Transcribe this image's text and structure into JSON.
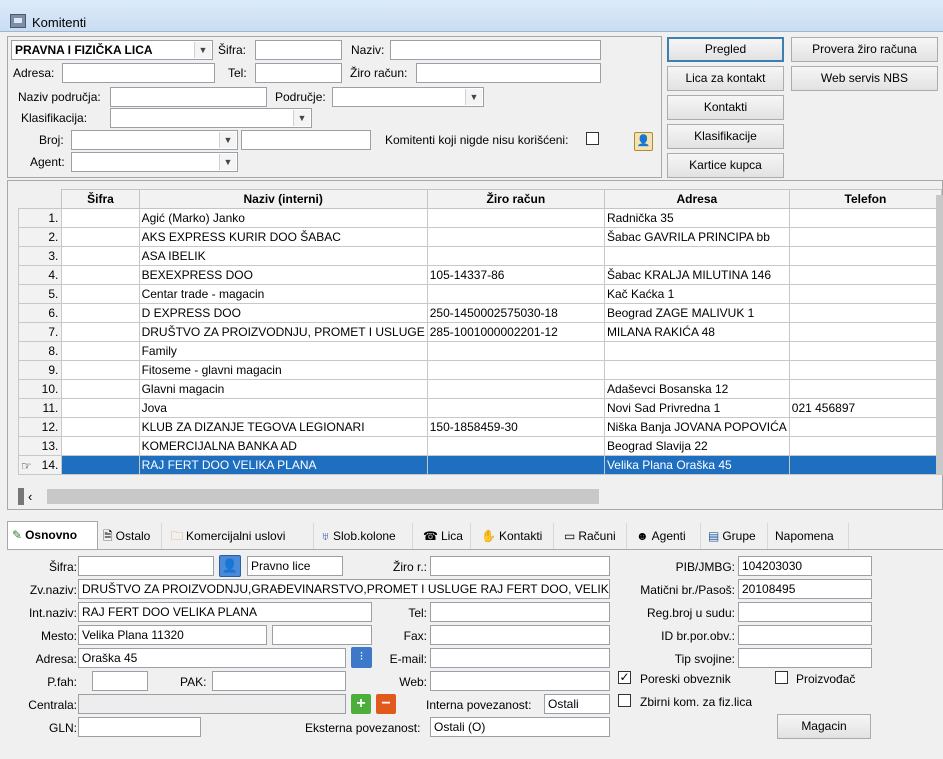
{
  "window": {
    "title": "Komitenti"
  },
  "filter": {
    "type_value": "PRAVNA I FIZIČKA LICA",
    "sifra_label": "Šifra:",
    "sifra_value": "",
    "naziv_label": "Naziv:",
    "naziv_value": "",
    "adresa_label": "Adresa:",
    "adresa_value": "",
    "tel_label": "Tel:",
    "tel_value": "",
    "ziro_label": "Žiro račun:",
    "ziro_value": "",
    "naziv_podrucja_label": "Naziv područja:",
    "naziv_podrucja_value": "",
    "podrucje_label": "Područje:",
    "podrucje_value": "",
    "klasifikacija_label": "Klasifikacija:",
    "klasifikacija_value": "",
    "broj_label": "Broj:",
    "broj_value": "",
    "broj_extra_value": "",
    "agent_label": "Agent:",
    "agent_value": "",
    "nekorisceni_label": "Komitenti koji nigde nisu korišćeni:",
    "nekorisceni_checked": false
  },
  "buttons": {
    "pregled": "Pregled",
    "lica_za_kontakt": "Lica za kontakt",
    "kontakti": "Kontakti",
    "klasifikacije": "Klasifikacije",
    "kartice_kupca": "Kartice kupca",
    "provera_ziro": "Provera žiro računa",
    "web_servis": "Web servis NBS"
  },
  "grid": {
    "columns": [
      "Šifra",
      "Naziv (interni)",
      "Žiro račun",
      "Adresa",
      "Telefon"
    ],
    "rows": [
      {
        "n": "1.",
        "sifra": "",
        "naziv": "Agić (Marko) Janko",
        "ziro": "",
        "adresa": "Radnička 35",
        "telefon": ""
      },
      {
        "n": "2.",
        "sifra": "",
        "naziv": "AKS EXPRESS KURIR DOO ŠABAC",
        "ziro": "",
        "adresa": "Šabac GAVRILA PRINCIPA bb",
        "telefon": ""
      },
      {
        "n": "3.",
        "sifra": "",
        "naziv": "ASA IBELIK",
        "ziro": "",
        "adresa": "",
        "telefon": ""
      },
      {
        "n": "4.",
        "sifra": "",
        "naziv": "BEXEXPRESS DOO",
        "ziro": "105-14337-86",
        "adresa": "Šabac KRALJA MILUTINA 146",
        "telefon": ""
      },
      {
        "n": "5.",
        "sifra": "",
        "naziv": "Centar trade - magacin",
        "ziro": "",
        "adresa": "Kač Kaćka 1",
        "telefon": ""
      },
      {
        "n": "6.",
        "sifra": "",
        "naziv": "D EXPRESS DOO",
        "ziro": "250-1450002575030-18",
        "adresa": "Beograd ZAGE MALIVUK 1",
        "telefon": ""
      },
      {
        "n": "7.",
        "sifra": "",
        "naziv": "DRUŠTVO ZA PROIZVODNJU, PROMET I USLUGE",
        "ziro": "285-1001000002201-12",
        "adresa": "MILANA RAKIĆA 48",
        "telefon": ""
      },
      {
        "n": "8.",
        "sifra": "",
        "naziv": "Family",
        "ziro": "",
        "adresa": "",
        "telefon": ""
      },
      {
        "n": "9.",
        "sifra": "",
        "naziv": "Fitoseme - glavni magacin",
        "ziro": "",
        "adresa": "",
        "telefon": ""
      },
      {
        "n": "10.",
        "sifra": "",
        "naziv": "Glavni magacin",
        "ziro": "",
        "adresa": "Adaševci Bosanska 12",
        "telefon": ""
      },
      {
        "n": "11.",
        "sifra": "",
        "naziv": "Jova",
        "ziro": "",
        "adresa": "Novi Sad Privredna 1",
        "telefon": "021 456897"
      },
      {
        "n": "12.",
        "sifra": "",
        "naziv": "KLUB ZA DIZANJE TEGOVA  LEGIONARI",
        "ziro": "150-1858459-30",
        "adresa": "Niška Banja JOVANA POPOVIĆA",
        "telefon": ""
      },
      {
        "n": "13.",
        "sifra": "",
        "naziv": "KOMERCIJALNA BANKA AD",
        "ziro": "",
        "adresa": "Beograd Slavija 22",
        "telefon": ""
      },
      {
        "n": "14.",
        "sifra": "",
        "naziv": "RAJ FERT DOO VELIKA PLANA",
        "ziro": "",
        "adresa": "Velika Plana Oraška 45",
        "telefon": ""
      }
    ],
    "selected_row": 14
  },
  "tabs": [
    "Osnovno",
    "Ostalo",
    "Komercijalni uslovi",
    "Slob.kolone",
    "Lica",
    "Kontakti",
    "Računi",
    "Agenti",
    "Grupe",
    "Napomena"
  ],
  "detail": {
    "sifra_label": "Šifra:",
    "sifra_value": "",
    "tip_value": "Pravno lice",
    "ziro_label": "Žiro r.:",
    "ziro_value": "",
    "pib_label": "PIB/JMBG:",
    "pib_value": "104203030",
    "zvnaziv_label": "Zv.naziv:",
    "zvnaziv_value": "DRUŠTVO ZA PROIZVODNJU,GRAĐEVINARSTVO,PROMET I USLUGE RAJ FERT DOO, VELIKA PLANA",
    "maticni_label": "Matični br./Pasoš:",
    "maticni_value": "20108495",
    "intnaziv_label": "Int.naziv:",
    "intnaziv_value": "RAJ FERT DOO VELIKA PLANA",
    "tel_label": "Tel:",
    "tel_value": "",
    "regbroj_label": "Reg.broj u sudu:",
    "regbroj_value": "",
    "mesto_label": "Mesto:",
    "mesto_value": "Velika Plana  11320",
    "mesto_extra": "",
    "fax_label": "Fax:",
    "fax_value": "",
    "idbr_label": "ID br.por.obv.:",
    "idbr_value": "",
    "adresa_label": "Adresa:",
    "adresa_value": "Oraška 45",
    "email_label": "E-mail:",
    "email_value": "",
    "tip_svojine_label": "Tip svojine:",
    "tip_svojine_value": "",
    "pfah_label": "P.fah:",
    "pfah_value": "",
    "pak_label": "PAK:",
    "pak_value": "",
    "web_label": "Web:",
    "web_value": "",
    "poreski_label": "Poreski obveznik",
    "poreski_checked": true,
    "proizvodjac_label": "Proizvođač",
    "proizvodjac_checked": false,
    "centrala_label": "Centrala:",
    "centrala_value": "",
    "interna_label": "Interna povezanost:",
    "interna_value": "Ostali",
    "zbirni_label": "Zbirni kom. za fiz.lica",
    "zbirni_checked": false,
    "gln_label": "GLN:",
    "gln_value": "",
    "eksterna_label": "Eksterna povezanost:",
    "eksterna_value": "Ostali (O)",
    "magacin_button": "Magacin"
  },
  "colors": {
    "selection": "#1f6fc0",
    "default_button_border": "#3c7fb1",
    "add_button": "#4caf3a",
    "remove_button": "#e05a1e"
  }
}
